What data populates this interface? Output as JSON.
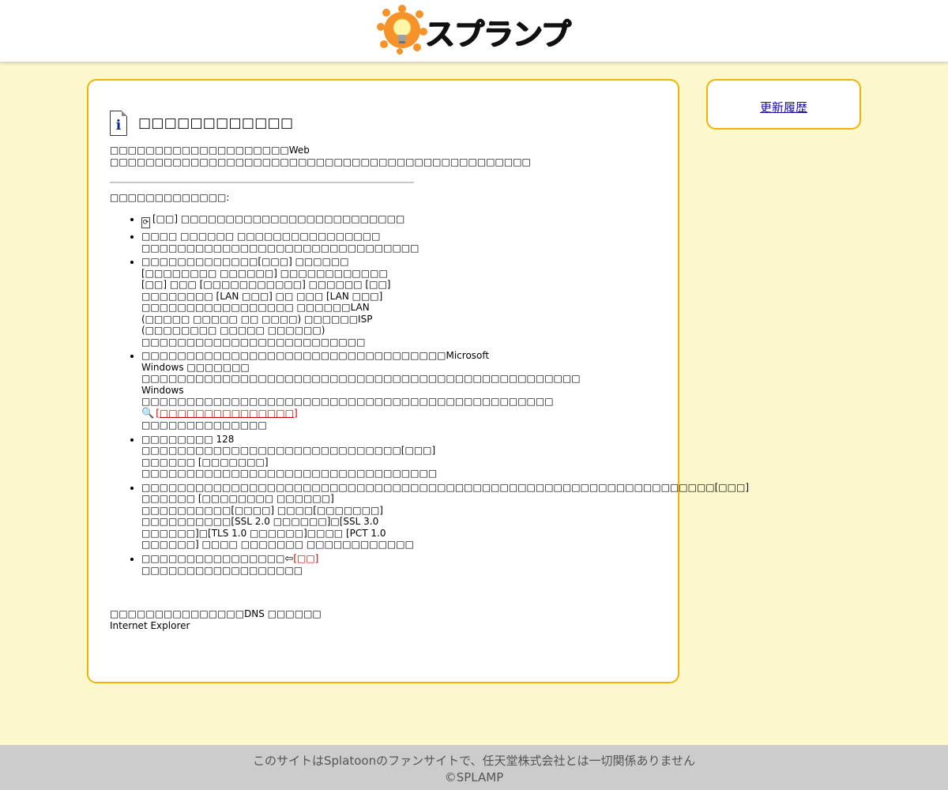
{
  "header": {
    "logo_text": "スプランプ"
  },
  "side": {
    "history_link": "更新履歴"
  },
  "main": {
    "title": "□□□□□□□□□□□□",
    "intro": "□□□□□□□□□□□□□□□□□□□□Web □□□□□□□□□□□□□□□□□□□□□□□□□□□□□□□□□□□□□□□□□□□□□□□",
    "try_label": "□□□□□□□□□□□□□:",
    "info_glyph": "i",
    "items": [
      {
        "prefix": "[□□]",
        "text": " □□□□□□□□□□□□□□□□□□□□□□□□□"
      },
      {
        "text": "□□□□ □□□□□□ □□□□□□□□□□□□□□□□ □□□□□□□□□□□□□□□□□□□□□□□□□□□□□□□"
      },
      {
        "text": "□□□□□□□□□□□□□[□□□] □□□□□□ [□□□□□□□□ □□□□□□] □□□□□□□□□□□□ [□□] □□□ [□□□□□□□□□□□] □□□□□□ [□□] □□□□□□□□ [LAN □□□] □□ □□□ [LAN □□□] □□□□□□□□□□□□□□□□□ □□□□□□LAN (□□□□□ □□□□□ □□ □□□□) □□□□□□ISP (□□□□□□□□ □□□□□ □□□□□□) □□□□□□□□□□□□□□□□□□□□□□□□□"
      },
      {
        "line1": "□□□□□□□□□□□□□□□□□□□□□□□□□□□□□□□□□□Microsoft Windows □□□□□□□ □□□□□□□□□□□□□□□□□□□□□□□□□□□□□□□□□□□□□□□□□□□□□□□□□",
        "line2": "Windows □□□□□□□□□□□□□□□□□□□□□□□□□□□□□□□□□□□□□□□□□□□□□□",
        "link": "[□□□□□□□□□□□□□□□]",
        "link_after": " □□□□□□□□□□□□□□"
      },
      {
        "text": "□□□□□□□□ 128 □□□□□□□□□□□□□□□□□□□□□□□□□□□□□[□□□] □□□□□□ [□□□□□□□] □□□□□□□□□□□□□□□□□□□□□□□□□□□□□□□□□"
      },
      {
        "text": "□□□□□□□□□□□□□□□□□□□□□□□□□□□□□□□□□□□□□□□□□□□□□□□□□□□□□□□□□□□□□□□□[□□□] □□□□□□ [□□□□□□□□ □□□□□□] □□□□□□□□□□[□□□□] □□□□[□□□□□□□] □□□□□□□□□□[SSL 2.0 □□□□□□]□[SSL 3.0 □□□□□□]□[TLS 1.0 □□□□□□]□□□□ [PCT 1.0 □□□□□□] □□□□ □□□□□□□ □□□□□□□□□□□□"
      },
      {
        "text": "□□□□□□□□□□□□□□□□",
        "link": "[□□]",
        "after": " □□□□□□□□□□□□□□□□□□"
      }
    ],
    "footnote_line1": "□□□□□□□□□□□□□□□DNS □□□□□□",
    "footnote_line2": "Internet Explorer"
  },
  "footer": {
    "line1": "このサイトはSplatoonのファンサイトで、任天堂株式会社とは一切関係ありません",
    "line2": "©SPLAMP"
  }
}
